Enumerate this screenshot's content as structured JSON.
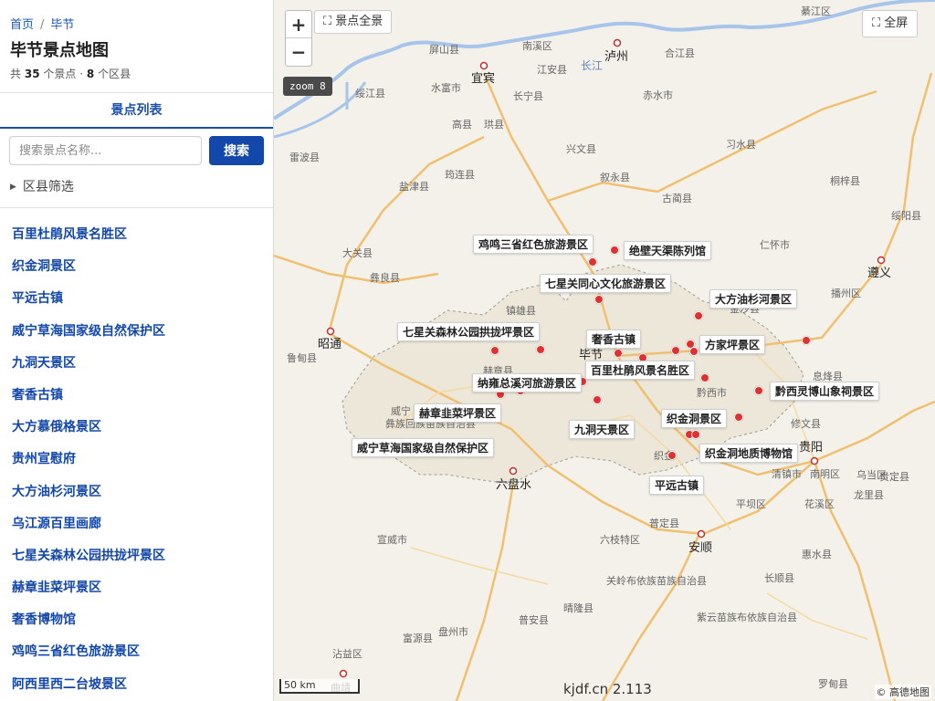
{
  "breadcrumb": {
    "home": "首页",
    "sep": "/",
    "current": "毕节"
  },
  "page_title": "毕节景点地图",
  "stats": {
    "prefix": "共",
    "spots_count": "35",
    "spots_unit": "个景点",
    "dot": "·",
    "districts_count": "8",
    "districts_unit": "个区县"
  },
  "tab_label": "景点列表",
  "search": {
    "placeholder": "搜索景点名称...",
    "button": "搜索"
  },
  "filter_label": "区县筛选",
  "spots": [
    "百里杜鹃风景名胜区",
    "织金洞景区",
    "平远古镇",
    "威宁草海国家级自然保护区",
    "九洞天景区",
    "奢香古镇",
    "大方慕俄格景区",
    "贵州宣慰府",
    "大方油杉河景区",
    "乌江源百里画廊",
    "七星关森林公园拱拢坪景区",
    "赫章韭菜坪景区",
    "奢香博物馆",
    "鸡鸣三省红色旅游景区",
    "阿西里西二台坡景区"
  ],
  "map": {
    "zoom_in": "+",
    "zoom_out": "−",
    "overview_button": "景点全景",
    "fullscreen_button": "全屏",
    "zoom_badge": "zoom 8",
    "scale": "50 km",
    "version": "kjdf.cn 2.113",
    "attribution": "© 高德地图",
    "fullscreen_icon": "expand-icon",
    "colors": {
      "marker": "#e03030",
      "road": "#f0c070",
      "water": "#a7c5ea",
      "accent": "#1447aa"
    },
    "base_labels": [
      "綦江区",
      "屏山县",
      "南溪区",
      "泸州",
      "合江县",
      "宜宾",
      "江安县",
      "长江",
      "水富市",
      "绥江县",
      "长宁县",
      "赤水市",
      "高县",
      "珙县",
      "雷波县",
      "兴文县",
      "习水县",
      "筠连县",
      "叙永县",
      "盐津县",
      "古蔺县",
      "桐梓县",
      "大关县",
      "绥阳县",
      "仁怀市",
      "彝良县",
      "遵义",
      "播州区",
      "镇雄县",
      "金沙县",
      "昭通",
      "鲁甸县",
      "毕节",
      "赫章县",
      "息烽县",
      "黔西市",
      "威宁",
      "彝族回族苗族自治县",
      "修文县",
      "贵阳",
      "织金",
      "六盘水",
      "清镇市",
      "南明区",
      "乌当区",
      "贵定县",
      "龙里县",
      "平坝区",
      "花溪区",
      "普定县",
      "宣威市",
      "安顺",
      "六枝特区",
      "惠水县",
      "关岭布依族苗族自治县",
      "长顺县",
      "晴隆县",
      "紫云苗族布依族自治县",
      "富源县",
      "盘州市",
      "普安县",
      "沾益区",
      "曲靖",
      "罗甸县"
    ],
    "spot_labels": [
      "鸡鸣三省红色旅游景区",
      "绝壁天渠陈列馆",
      "七星关同心文化旅游景区",
      "大方油杉河景区",
      "七星关森林公园拱拢坪景区",
      "奢香古镇",
      "方家坪景区",
      "百里杜鹃风景名胜区",
      "纳雍总溪河旅游景区",
      "黔西灵博山象祠景区",
      "赫章韭菜坪景区",
      "九洞天景区",
      "织金洞景区",
      "威宁草海国家级自然保护区",
      "织金洞地质博物馆",
      "平远古镇"
    ]
  }
}
